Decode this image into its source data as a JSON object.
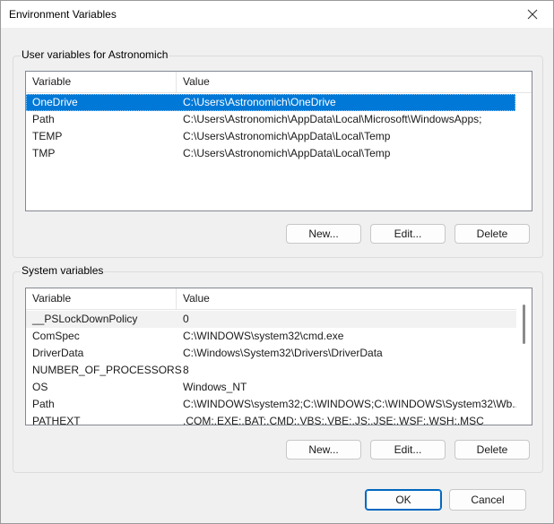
{
  "window": {
    "title": "Environment Variables"
  },
  "user_group": {
    "title": "User variables for Astronomich",
    "columns": [
      "Variable",
      "Value"
    ],
    "rows": [
      {
        "name": "OneDrive",
        "value": "C:\\Users\\Astronomich\\OneDrive"
      },
      {
        "name": "Path",
        "value": "C:\\Users\\Astronomich\\AppData\\Local\\Microsoft\\WindowsApps;"
      },
      {
        "name": "TEMP",
        "value": "C:\\Users\\Astronomich\\AppData\\Local\\Temp"
      },
      {
        "name": "TMP",
        "value": "C:\\Users\\Astronomich\\AppData\\Local\\Temp"
      }
    ],
    "buttons": {
      "new": "New...",
      "edit": "Edit...",
      "delete": "Delete"
    }
  },
  "system_group": {
    "title": "System variables",
    "columns": [
      "Variable",
      "Value"
    ],
    "rows": [
      {
        "name": "__PSLockDownPolicy",
        "value": "0"
      },
      {
        "name": "ComSpec",
        "value": "C:\\WINDOWS\\system32\\cmd.exe"
      },
      {
        "name": "DriverData",
        "value": "C:\\Windows\\System32\\Drivers\\DriverData"
      },
      {
        "name": "NUMBER_OF_PROCESSORS",
        "value": "8"
      },
      {
        "name": "OS",
        "value": "Windows_NT"
      },
      {
        "name": "Path",
        "value": "C:\\WINDOWS\\system32;C:\\WINDOWS;C:\\WINDOWS\\System32\\Wb..."
      },
      {
        "name": "PATHEXT",
        "value": ".COM;.EXE;.BAT;.CMD;.VBS;.VBE;.JS;.JSE;.WSF;.WSH;.MSC"
      }
    ],
    "buttons": {
      "new": "New...",
      "edit": "Edit...",
      "delete": "Delete"
    }
  },
  "footer": {
    "ok": "OK",
    "cancel": "Cancel"
  },
  "colors": {
    "selection": "#0078d7",
    "accent_border": "#0067c0",
    "dialog_bg": "#f0f0f0"
  }
}
